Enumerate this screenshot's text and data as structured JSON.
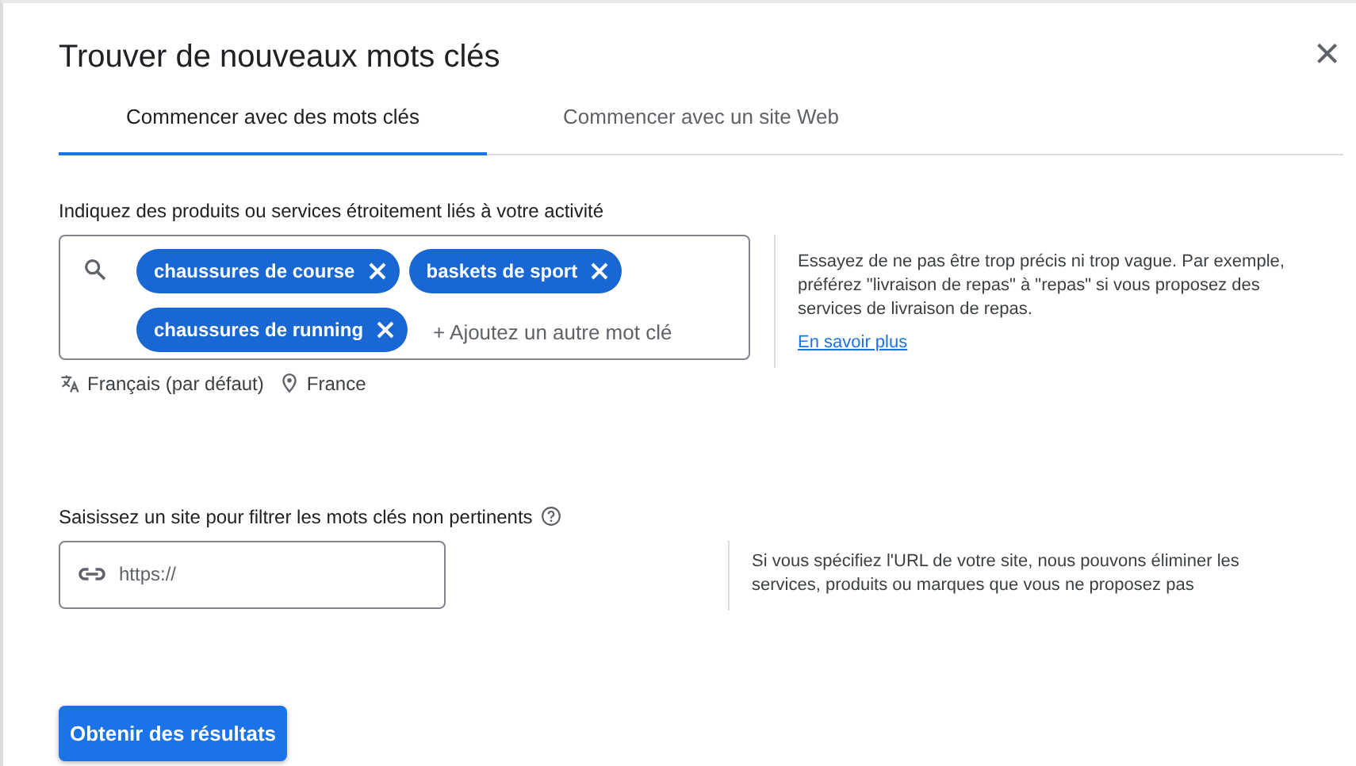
{
  "dialog": {
    "title": "Trouver de nouveaux mots clés",
    "close": "×"
  },
  "tabs": [
    {
      "label": "Commencer avec des mots clés",
      "selected": true
    },
    {
      "label": "Commencer avec un site Web",
      "selected": false
    }
  ],
  "keywords": {
    "label": "Indiquez des produits ou services étroitement liés à votre activité",
    "chips": [
      {
        "text": "chaussures de course"
      },
      {
        "text": "baskets de sport"
      },
      {
        "text": "chaussures de running"
      }
    ],
    "add_placeholder": "+ Ajoutez un autre mot clé",
    "language": "Français (par défaut)",
    "location": "France",
    "tip": "Essayez de ne pas être trop précis ni trop vague. Par exemple, préférez \"livraison de repas\" à \"repas\" si vous proposez des services de livraison de repas.",
    "link": "En savoir plus"
  },
  "site": {
    "label": "Saisissez un site pour filtrer les mots clés non pertinents",
    "placeholder": "https://",
    "tip": "Si vous spécifiez l'URL de votre site, nous pouvons éliminer les services, produits ou marques que vous ne proposez pas"
  },
  "submit": "Obtenir des résultats"
}
